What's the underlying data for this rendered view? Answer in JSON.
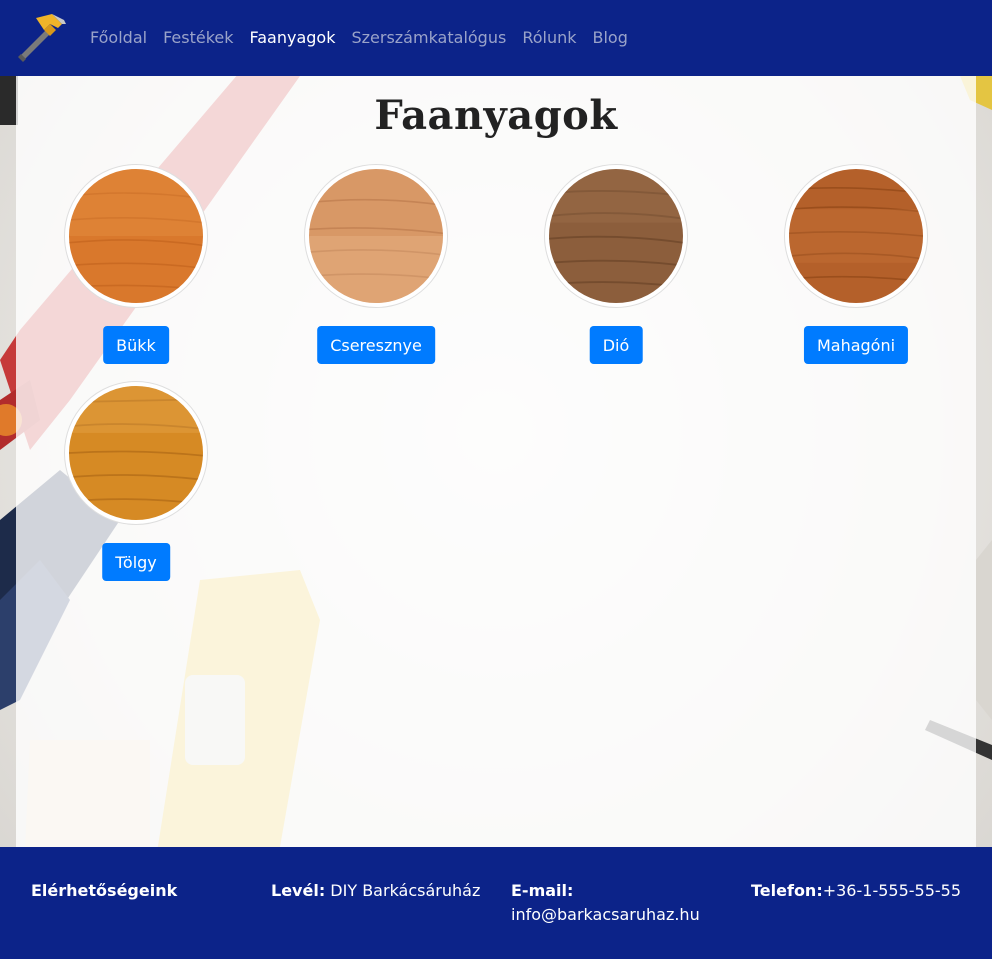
{
  "nav": {
    "brand_icon": "hammer-icon",
    "links": [
      {
        "label": "Főoldal",
        "active": false
      },
      {
        "label": "Festékek",
        "active": false
      },
      {
        "label": "Faanyagok",
        "active": true
      },
      {
        "label": "Szerszámkatalógus",
        "active": false
      },
      {
        "label": "Rólunk",
        "active": false
      },
      {
        "label": "Blog",
        "active": false
      }
    ]
  },
  "main": {
    "title": "Faanyagok",
    "woods": [
      {
        "label": "Bükk",
        "color": "#d9782c"
      },
      {
        "label": "Cseresznye",
        "color": "#d89866"
      },
      {
        "label": "Dió",
        "color": "#8c5e3c"
      },
      {
        "label": "Mahagóni",
        "color": "#b4602a"
      },
      {
        "label": "Tölgy",
        "color": "#d68a24"
      }
    ]
  },
  "footer": {
    "heading": "Elérhetőségeink",
    "mail_label": "Levél:",
    "mail_value": " DIY Barkácsáruház",
    "email_label": "E-mail:",
    "email_value": "info@barkacsaruhaz.hu",
    "phone_label": "Telefon:",
    "phone_value": "+36-1-555-55-55"
  },
  "colors": {
    "navbar": "#0c2389",
    "button": "#007bff"
  }
}
